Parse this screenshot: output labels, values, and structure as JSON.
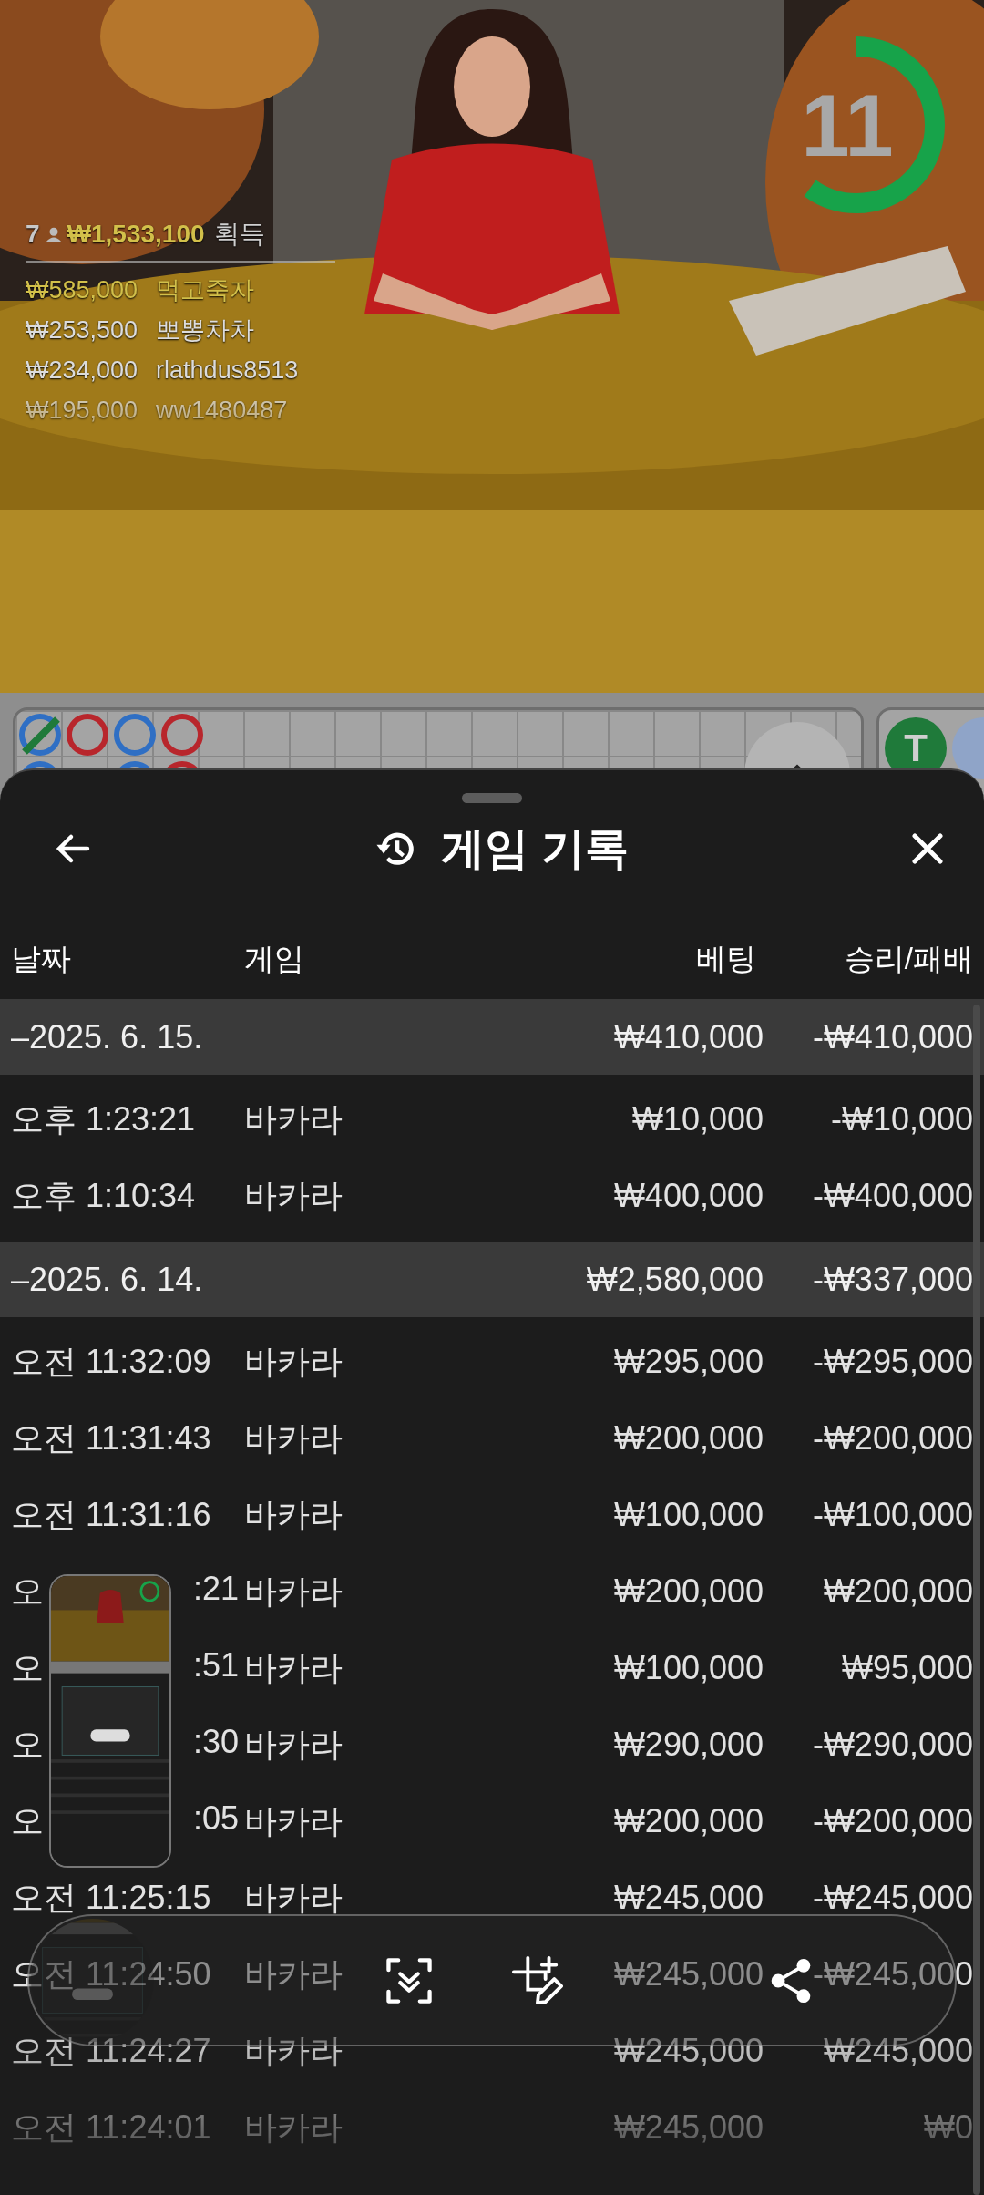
{
  "video": {
    "kind": "picture",
    "timer": {
      "value": "11",
      "level": 0.6
    },
    "leaderboard": {
      "players": "7",
      "total": "₩1,533,100",
      "total_label": "획득",
      "entries": [
        {
          "amount": "₩585,000",
          "name": "먹고죽자",
          "selected": true
        },
        {
          "amount": "₩253,500",
          "name": "뽀뽕차차",
          "selected": false
        },
        {
          "amount": "₩234,000",
          "name": "rlathdus8513",
          "selected": false
        },
        {
          "amount": "₩195,000",
          "name": "ww1480487",
          "selected": false
        }
      ]
    }
  },
  "road": {
    "columns": [
      {
        "beads": [
          {
            "color": "#2f6fc4",
            "tie": true
          },
          {
            "color": "#2f6fc4",
            "tie": false
          }
        ]
      },
      {
        "beads": [
          {
            "color": "#b8262c",
            "tie": false
          }
        ]
      },
      {
        "beads": [
          {
            "color": "#2f6fc4",
            "tie": false
          },
          {
            "color": "#2f6fc4",
            "tie": false
          }
        ]
      },
      {
        "beads": [
          {
            "color": "#b8262c",
            "tie": false
          },
          {
            "color": "#b8262c",
            "tie": false
          }
        ]
      }
    ],
    "side_badge": "T"
  },
  "sheet": {
    "title": "게임 기록",
    "columns": [
      "날짜",
      "게임",
      "베팅",
      "승리/패배"
    ],
    "groups": [
      {
        "date": "–2025. 6. 15.",
        "bet": "₩410,000",
        "result": "-₩410,000",
        "rows": [
          {
            "time": "오후 1:23:21",
            "game": "바카라",
            "bet": "₩10,000",
            "result": "-₩10,000"
          },
          {
            "time": "오후 1:10:34",
            "game": "바카라",
            "bet": "₩400,000",
            "result": "-₩400,000"
          }
        ]
      },
      {
        "date": "–2025. 6. 14.",
        "bet": "₩2,580,000",
        "result": "-₩337,000",
        "rows": [
          {
            "time": "오전 11:32:09",
            "game": "바카라",
            "bet": "₩295,000",
            "result": "-₩295,000"
          },
          {
            "time": "오전 11:31:43",
            "game": "바카라",
            "bet": "₩200,000",
            "result": "-₩200,000"
          },
          {
            "time": "오전 11:31:16",
            "game": "바카라",
            "bet": "₩100,000",
            "result": "-₩100,000"
          },
          {
            "time": "오",
            "time_tail": ":21",
            "game": "바카라",
            "bet": "₩200,000",
            "result": "₩200,000"
          },
          {
            "time": "오",
            "time_tail": ":51",
            "game": "바카라",
            "bet": "₩100,000",
            "result": "₩95,000"
          },
          {
            "time": "오",
            "time_tail": ":30",
            "game": "바카라",
            "bet": "₩290,000",
            "result": "-₩290,000"
          },
          {
            "time": "오",
            "time_tail": ":05",
            "game": "바카라",
            "bet": "₩200,000",
            "result": "-₩200,000"
          },
          {
            "time": "오전 11:25:15",
            "game": "바카라",
            "bet": "₩245,000",
            "result": "-₩245,000"
          },
          {
            "time": "오전 11:24:50",
            "game": "바카라",
            "bet": "₩245,000",
            "result": "-₩245,000"
          },
          {
            "time": "오전 11:24:27",
            "game": "바카라",
            "bet": "₩245,000",
            "result": "₩245,000"
          },
          {
            "time": "오전 11:24:01",
            "game": "바카라",
            "bet": "₩245,000",
            "result": "₩0"
          }
        ]
      }
    ]
  }
}
